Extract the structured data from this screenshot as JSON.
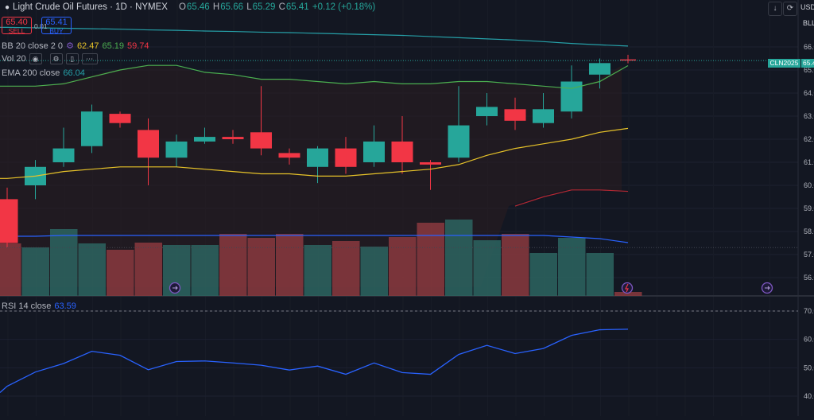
{
  "header": {
    "symbol_title": "Light Crude Oil Futures · 1D · NYMEX",
    "ohlc": {
      "o_label": "O",
      "o": "65.46",
      "h_label": "H",
      "h": "65.66",
      "l_label": "L",
      "l": "65.29",
      "c_label": "C",
      "c": "65.41",
      "change": "+0.12 (+0.18%)"
    },
    "currency": "USD",
    "currency_unit": "BLL",
    "down_arrow_icon": "arrow-down-icon",
    "restore_icon": "restore-icon"
  },
  "trade": {
    "sell_price": "65.40",
    "sell_label": "SELL",
    "spread": "0.01",
    "buy_price": "65.41",
    "buy_label": "BUY"
  },
  "indicators": {
    "bb_label": "BB 20 close 2 0",
    "bb_values": [
      "62.47",
      "65.19",
      "59.74"
    ],
    "vol_label": "Vol 20",
    "ema_label": "EMA 200 close",
    "ema_value": "66.04",
    "rsi_label": "RSI 14 close",
    "rsi_value": "63.59"
  },
  "price_tag": {
    "symbol": "CLN2025",
    "value": "65.4"
  },
  "colors": {
    "bull": "#26a69a",
    "bear": "#f23645",
    "bg": "#131722",
    "bb_upper": "#4caf50",
    "bb_basis": "#e6c229",
    "bb_lower": "#b22833",
    "ema": "#26a0a8",
    "rsi": "#2962ff",
    "vol_ma": "#2962ff"
  },
  "chart_data": [
    {
      "type": "candlestick",
      "title": "Light Crude Oil Futures · 1D · NYMEX",
      "ylim": [
        55.6,
        66.5
      ],
      "yticks": [
        56.0,
        57.0,
        58.0,
        59.0,
        60.0,
        61.0,
        62.0,
        63.0,
        64.0,
        65.0,
        66.0
      ],
      "ohlc": [
        [
          59.4,
          59.9,
          57.3,
          57.5
        ],
        [
          60.0,
          61.1,
          59.4,
          60.8
        ],
        [
          61.0,
          62.5,
          60.8,
          61.6
        ],
        [
          61.7,
          63.5,
          61.4,
          63.2
        ],
        [
          63.1,
          63.2,
          62.5,
          62.7
        ],
        [
          62.4,
          62.9,
          60.0,
          61.2
        ],
        [
          61.2,
          62.2,
          60.8,
          61.9
        ],
        [
          61.9,
          62.5,
          61.8,
          62.1
        ],
        [
          62.1,
          62.4,
          61.8,
          62.0
        ],
        [
          62.3,
          64.3,
          61.3,
          61.6
        ],
        [
          61.4,
          61.6,
          60.9,
          61.2
        ],
        [
          60.8,
          61.7,
          60.1,
          61.6
        ],
        [
          61.6,
          62.1,
          60.5,
          60.8
        ],
        [
          61.0,
          62.6,
          60.8,
          61.9
        ],
        [
          61.9,
          63.0,
          60.5,
          61.0
        ],
        [
          61.0,
          61.1,
          59.8,
          60.9
        ],
        [
          61.2,
          64.3,
          61.0,
          62.6
        ],
        [
          63.0,
          64.0,
          62.6,
          63.4
        ],
        [
          63.3,
          63.8,
          62.4,
          62.8
        ],
        [
          62.7,
          64.0,
          62.5,
          63.3
        ],
        [
          63.2,
          65.2,
          62.9,
          64.5
        ],
        [
          64.8,
          65.5,
          64.2,
          65.3
        ],
        [
          65.46,
          65.66,
          65.29,
          65.41
        ]
      ],
      "bb_upper": [
        64.3,
        64.3,
        64.4,
        64.7,
        65.0,
        65.2,
        65.2,
        64.9,
        64.8,
        64.6,
        64.6,
        64.5,
        64.4,
        64.5,
        64.4,
        64.4,
        64.5,
        64.5,
        64.4,
        64.3,
        64.2,
        64.5,
        65.19
      ],
      "bb_basis": [
        60.3,
        60.4,
        60.6,
        60.7,
        60.8,
        60.8,
        60.8,
        60.7,
        60.6,
        60.5,
        60.5,
        60.4,
        60.4,
        60.5,
        60.6,
        60.7,
        60.9,
        61.3,
        61.6,
        61.8,
        62.0,
        62.3,
        62.47
      ],
      "bb_lower": [
        null,
        null,
        null,
        null,
        null,
        null,
        null,
        null,
        null,
        null,
        null,
        null,
        null,
        null,
        null,
        null,
        null,
        null,
        59.1,
        59.5,
        59.8,
        59.8,
        59.74
      ],
      "ema200": [
        66.85,
        66.83,
        66.81,
        66.79,
        66.77,
        66.74,
        66.72,
        66.69,
        66.67,
        66.64,
        66.62,
        66.59,
        66.56,
        66.53,
        66.5,
        66.45,
        66.4,
        66.35,
        66.3,
        66.23,
        66.15,
        66.09,
        66.04
      ],
      "volume": [
        0.66,
        0.61,
        0.84,
        0.66,
        0.58,
        0.67,
        0.64,
        0.64,
        0.78,
        0.73,
        0.78,
        0.64,
        0.69,
        0.62,
        0.74,
        0.92,
        0.96,
        0.7,
        0.78,
        0.54,
        0.73,
        0.54,
        0.05
      ],
      "volume_ma": [
        0.75,
        0.75,
        0.76,
        0.76,
        0.76,
        0.76,
        0.76,
        0.76,
        0.76,
        0.76,
        0.76,
        0.76,
        0.76,
        0.76,
        0.76,
        0.76,
        0.76,
        0.76,
        0.76,
        0.76,
        0.74,
        0.72,
        0.67
      ]
    },
    {
      "type": "line",
      "title": "RSI 14 close",
      "ylim": [
        37.5,
        72
      ],
      "yticks": [
        40.0,
        50.0,
        60.0,
        70.0
      ],
      "values": [
        43.5,
        48.5,
        51.5,
        55.8,
        54.4,
        49.3,
        52.2,
        52.4,
        51.7,
        50.9,
        49.2,
        50.6,
        47.7,
        51.7,
        48.3,
        47.7,
        54.7,
        57.9,
        55.0,
        56.8,
        61.4,
        63.4,
        63.59
      ]
    }
  ]
}
